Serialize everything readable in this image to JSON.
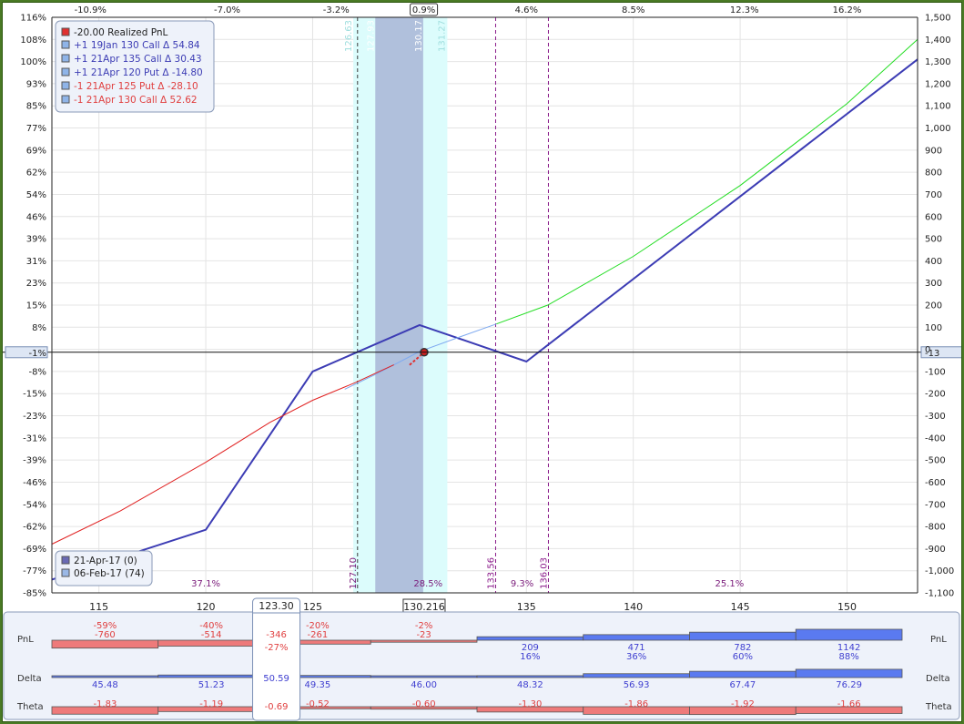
{
  "chart_data": {
    "type": "line",
    "x_axis": {
      "label": "",
      "min": 112.8,
      "max": 153.3,
      "ticks": [
        115,
        120,
        125,
        130,
        135,
        140,
        145,
        150
      ]
    },
    "top_axis_ticks": [
      {
        "x": 114.6,
        "label": "-10.9%"
      },
      {
        "x": 121.0,
        "label": "-7.0%"
      },
      {
        "x": 126.1,
        "label": "-3.2%"
      },
      {
        "x": 130.2,
        "label": "0.9%",
        "boxed": true
      },
      {
        "x": 135.0,
        "label": "4.6%"
      },
      {
        "x": 140.0,
        "label": "8.5%"
      },
      {
        "x": 145.2,
        "label": "12.3%"
      },
      {
        "x": 150.0,
        "label": "16.2%"
      }
    ],
    "y_left_ticks": [
      "116%",
      "108%",
      "100%",
      "93%",
      "85%",
      "77%",
      "69%",
      "62%",
      "54%",
      "46%",
      "39%",
      "31%",
      "23%",
      "15%",
      "8%",
      "-1%",
      "-8%",
      "-15%",
      "-23%",
      "-31%",
      "-39%",
      "-46%",
      "-54%",
      "-62%",
      "-69%",
      "-77%",
      "-85%"
    ],
    "y_right_axis": {
      "min": -1100,
      "max": 1500,
      "step": 100
    },
    "y_right_labels": [
      "1,500",
      "1,400",
      "1,300",
      "1,200",
      "1,100",
      "1,000",
      "900",
      "800",
      "700",
      "600",
      "500",
      "400",
      "300",
      "200",
      "100",
      "0",
      "-100",
      "-200",
      "-300",
      "-400",
      "-500",
      "-600",
      "-700",
      "-800",
      "-900",
      "-1,000",
      "-1,100"
    ],
    "zero_line_value": -13,
    "zero_line_label": "-13",
    "left_zero_label": "-1%",
    "series": [
      {
        "name": "21-Apr-17 (0)",
        "color": "#3c3cb4",
        "width": 2,
        "points": [
          [
            112.8,
            -1040
          ],
          [
            120,
            -815
          ],
          [
            125,
            -100
          ],
          [
            130,
            110
          ],
          [
            135,
            -55
          ],
          [
            153.3,
            1310
          ]
        ]
      },
      {
        "name": "06-Feb-17 (74)",
        "color": "#7faaf0",
        "width": 1,
        "points": [
          [
            126.5,
            -180
          ],
          [
            128,
            -110
          ],
          [
            130,
            -10
          ],
          [
            132,
            60
          ],
          [
            133.6,
            115
          ]
        ]
      },
      {
        "name": "",
        "color": "#e02020",
        "width": 1,
        "points": [
          [
            112.8,
            -880
          ],
          [
            116,
            -730
          ],
          [
            120,
            -510
          ],
          [
            123,
            -330
          ],
          [
            125,
            -230
          ],
          [
            127,
            -150
          ],
          [
            128.8,
            -70
          ]
        ]
      },
      {
        "name": "",
        "color": "#22dd22",
        "width": 1,
        "points": [
          [
            133.6,
            115
          ],
          [
            136,
            200
          ],
          [
            140,
            420
          ],
          [
            145,
            740
          ],
          [
            150,
            1110
          ],
          [
            153.3,
            1400
          ]
        ]
      }
    ],
    "shaded_ranges": [
      {
        "from": 126.9,
        "to": 131.3,
        "color": "#dcfcfc"
      },
      {
        "from": 127.93,
        "to": 130.17,
        "color": "#b0c0dc"
      }
    ],
    "vertical_lines": [
      {
        "x": 127.1,
        "label": "127.10",
        "position": "bottom",
        "color": "#3c3c3c"
      },
      {
        "x": 133.56,
        "label": "133.56",
        "position": "bottom",
        "color": "#8a1a8a"
      },
      {
        "x": 136.03,
        "label": "136.03",
        "position": "bottom",
        "color": "#8a1a8a"
      },
      {
        "x": 126.9,
        "label": "126.63",
        "position": "top",
        "color": "#9fdede"
      },
      {
        "x": 127.93,
        "label": "127.93",
        "position": "top",
        "color": "#ffffff"
      },
      {
        "x": 130.17,
        "label": "130.17",
        "position": "top",
        "color": "#ffffff"
      },
      {
        "x": 131.27,
        "label": "131.27",
        "position": "top",
        "color": "#9fdede"
      }
    ],
    "range_labels": [
      {
        "x": 120,
        "label": "37.1%"
      },
      {
        "x": 130.4,
        "label": "28.5%"
      },
      {
        "x": 134.8,
        "label": "9.3%"
      },
      {
        "x": 144.5,
        "label": "25.1%"
      }
    ],
    "current_price": {
      "x": 130.216,
      "label": "130.216",
      "y": -13
    },
    "cursor_price": {
      "x": 123.3,
      "label": "123.30"
    },
    "legend": {
      "title": "-20.00 Realized PnL",
      "title_color": "#222222",
      "items": [
        {
          "text": "+1 19Jan 130 Call Δ   54.84",
          "color": "#3c3cb4"
        },
        {
          "text": "+1 21Apr 135 Call Δ   30.43",
          "color": "#3c3cb4"
        },
        {
          "text": "+1 21Apr 120 Put Δ   -14.80",
          "color": "#3c3cb4"
        },
        {
          "text": "-1 21Apr 125 Put Δ   -28.10",
          "color": "#e04040"
        },
        {
          "text": "-1 21Apr 130 Call Δ   52.62",
          "color": "#e04040"
        }
      ]
    },
    "date_legend": [
      {
        "text": "21-Apr-17 (0)",
        "color": "#6a6ab4"
      },
      {
        "text": "06-Feb-17 (74)",
        "color": "#9ab8e6"
      }
    ]
  },
  "bottom_panel": {
    "row_labels": {
      "pnl": "PnL",
      "delta": "Delta",
      "theta": "Theta"
    },
    "columns": [
      {
        "pnl": -760,
        "pnl_label": "-760",
        "pnl_pct": "-59%",
        "delta": "45.48",
        "delta_val": 45.48,
        "theta": "-1.83",
        "theta_val": -1.83
      },
      {
        "pnl": -514,
        "pnl_label": "-514",
        "pnl_pct": "-40%",
        "delta": "51.23",
        "delta_val": 51.23,
        "theta": "-1.19",
        "theta_val": -1.19
      },
      {
        "pnl": -261,
        "pnl_label": "-261",
        "pnl_pct": "-20%",
        "delta": "49.35",
        "delta_val": 49.35,
        "theta": "-0.52",
        "theta_val": -0.52
      },
      {
        "pnl": -23,
        "pnl_label": "-23",
        "pnl_pct": "-2%",
        "delta": "46.00",
        "delta_val": 46.0,
        "theta": "-0.60",
        "theta_val": -0.6
      },
      {
        "pnl": 209,
        "pnl_label": "209",
        "pnl_pct": "16%",
        "delta": "48.32",
        "delta_val": 48.32,
        "theta": "-1.30",
        "theta_val": -1.3
      },
      {
        "pnl": 471,
        "pnl_label": "471",
        "pnl_pct": "36%",
        "delta": "56.93",
        "delta_val": 56.93,
        "theta": "-1.86",
        "theta_val": -1.86
      },
      {
        "pnl": 782,
        "pnl_label": "782",
        "pnl_pct": "60%",
        "delta": "67.47",
        "delta_val": 67.47,
        "theta": "-1.92",
        "theta_val": -1.92
      },
      {
        "pnl": 1142,
        "pnl_label": "1142",
        "pnl_pct": "88%",
        "delta": "76.29",
        "delta_val": 76.29,
        "theta": "-1.66",
        "theta_val": -1.66
      }
    ],
    "cursor": {
      "pnl": "-346",
      "pnl_pct": "-27%",
      "delta": "50.59",
      "theta": "-0.69"
    }
  }
}
